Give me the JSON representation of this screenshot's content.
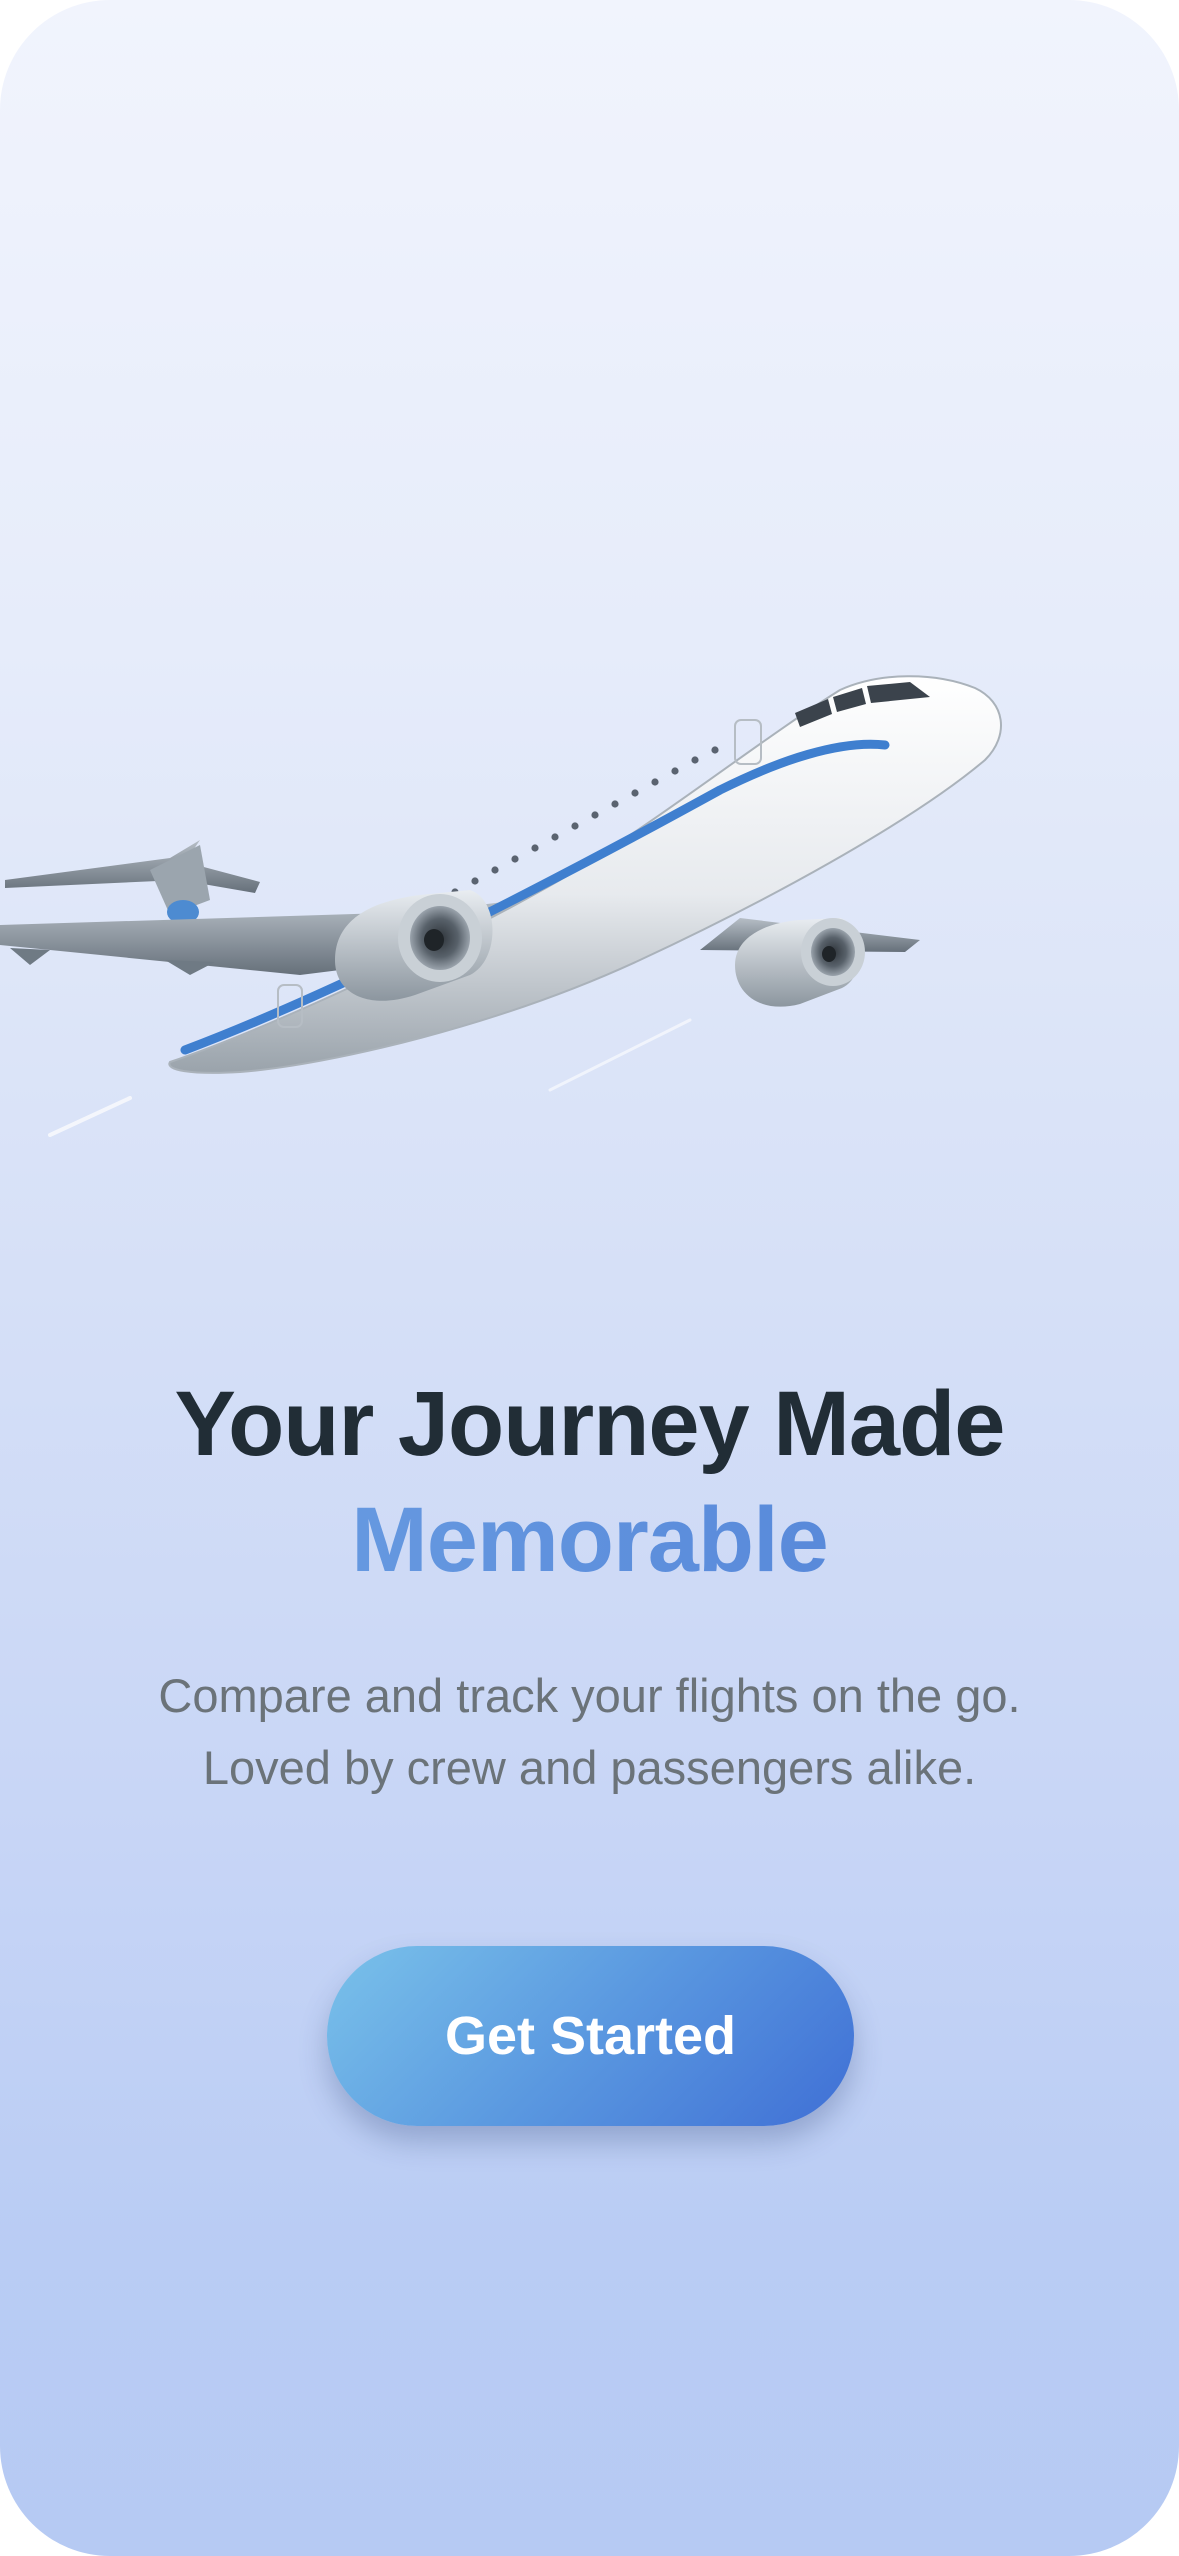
{
  "hero": {
    "illustration_icon": "airplane-icon"
  },
  "headline": {
    "line1": "Your Journey Made",
    "line2": "Memorable"
  },
  "subtitle": {
    "line1": "Compare and track your flights on the go.",
    "line2": "Loved by crew and passengers alike."
  },
  "cta": {
    "label": "Get Started"
  },
  "colors": {
    "headline_dark": "#212d36",
    "headline_accent": "#5b8fd8",
    "subtitle": "#6b7379",
    "button_start": "#7ac2ea",
    "button_end": "#3f6fd5",
    "background_top": "#f1f4fd",
    "background_bottom": "#b6caf3"
  }
}
